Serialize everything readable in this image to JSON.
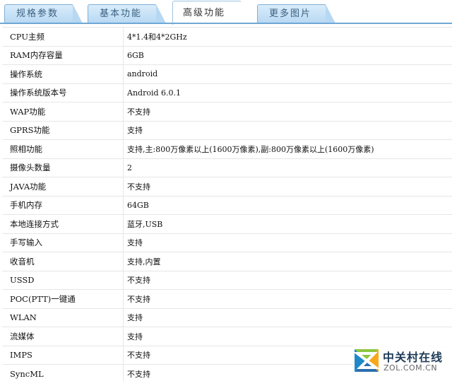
{
  "tabs": [
    {
      "label": "规格参数",
      "active": false
    },
    {
      "label": "基本功能",
      "active": false
    },
    {
      "label": "高级功能",
      "active": true
    },
    {
      "label": "更多图片",
      "active": false
    }
  ],
  "specs": [
    {
      "label": "CPU主频",
      "value": "4*1.4和4*2GHz"
    },
    {
      "label": "RAM内存容量",
      "value": "6GB"
    },
    {
      "label": "操作系统",
      "value": "android"
    },
    {
      "label": "操作系统版本号",
      "value": "Android 6.0.1"
    },
    {
      "label": "WAP功能",
      "value": "不支持"
    },
    {
      "label": "GPRS功能",
      "value": "支持"
    },
    {
      "label": "照相功能",
      "value": "支持,主:800万像素以上(1600万像素),副:800万像素以上(1600万像素)"
    },
    {
      "label": "摄像头数量",
      "value": "2"
    },
    {
      "label": "JAVA功能",
      "value": "不支持"
    },
    {
      "label": "手机内存",
      "value": "64GB"
    },
    {
      "label": "本地连接方式",
      "value": "蓝牙,USB"
    },
    {
      "label": "手写输入",
      "value": "支持"
    },
    {
      "label": "收音机",
      "value": "支持,内置"
    },
    {
      "label": "USSD",
      "value": "不支持"
    },
    {
      "label": "POC(PTT)一键通",
      "value": "不支持"
    },
    {
      "label": "WLAN",
      "value": "支持"
    },
    {
      "label": "流媒体",
      "value": "支持"
    },
    {
      "label": "IMPS",
      "value": "不支持"
    },
    {
      "label": "SyncML",
      "value": "不支持"
    }
  ],
  "watermark": {
    "name": "中关村在线",
    "domain": "ZOL.COM.CN"
  },
  "colors": {
    "tab_bg": "#b7d8f2",
    "tab_border": "#7fb0d8",
    "tab_text": "#3a5f80",
    "row_border": "#e6e6e6"
  }
}
